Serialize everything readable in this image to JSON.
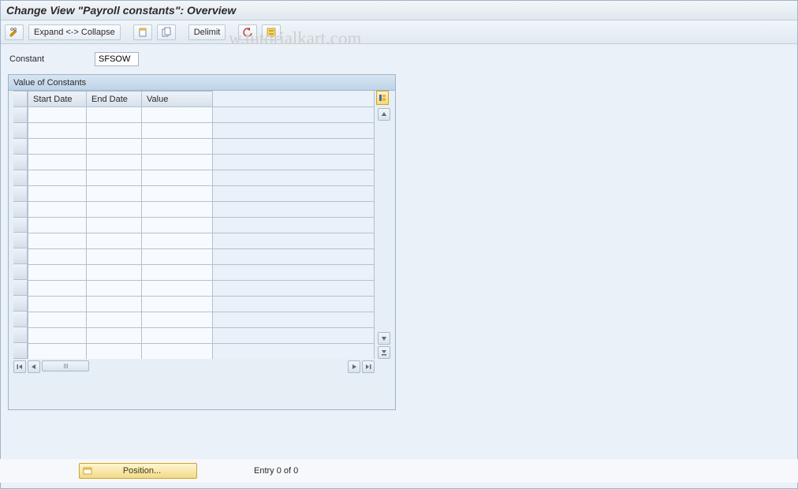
{
  "title": "Change View \"Payroll constants\": Overview",
  "watermark": "w.tutorialkart.com",
  "toolbar": {
    "expand_collapse_label": "Expand <-> Collapse",
    "delimit_label": "Delimit"
  },
  "field": {
    "label": "Constant",
    "value": "SFSOW"
  },
  "panel": {
    "title": "Value of Constants",
    "columns": [
      "Start Date",
      "End Date",
      "Value"
    ],
    "rows": [
      {
        "start": "",
        "end": "",
        "value": ""
      },
      {
        "start": "",
        "end": "",
        "value": ""
      },
      {
        "start": "",
        "end": "",
        "value": ""
      },
      {
        "start": "",
        "end": "",
        "value": ""
      },
      {
        "start": "",
        "end": "",
        "value": ""
      },
      {
        "start": "",
        "end": "",
        "value": ""
      },
      {
        "start": "",
        "end": "",
        "value": ""
      },
      {
        "start": "",
        "end": "",
        "value": ""
      },
      {
        "start": "",
        "end": "",
        "value": ""
      },
      {
        "start": "",
        "end": "",
        "value": ""
      },
      {
        "start": "",
        "end": "",
        "value": ""
      },
      {
        "start": "",
        "end": "",
        "value": ""
      },
      {
        "start": "",
        "end": "",
        "value": ""
      },
      {
        "start": "",
        "end": "",
        "value": ""
      },
      {
        "start": "",
        "end": "",
        "value": ""
      },
      {
        "start": "",
        "end": "",
        "value": ""
      }
    ]
  },
  "footer": {
    "position_label": "Position...",
    "entry_text": "Entry 0 of 0"
  }
}
